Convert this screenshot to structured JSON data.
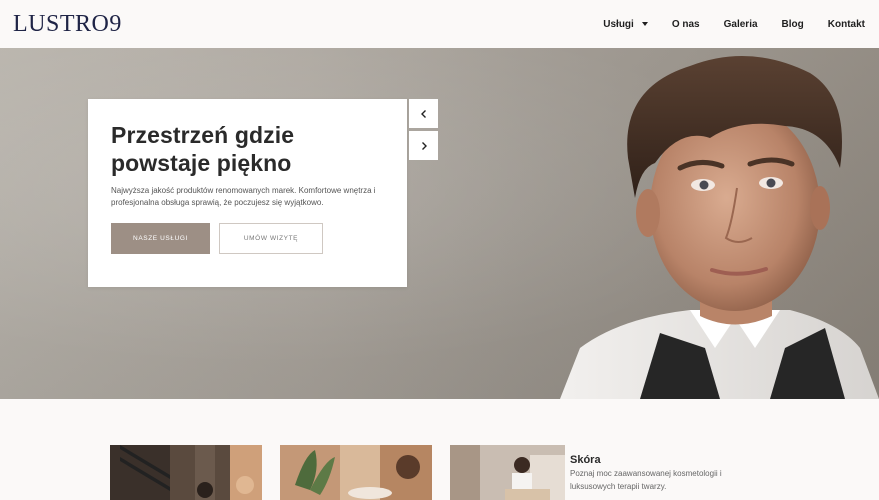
{
  "brand": {
    "logo_text": "LUSTRO9"
  },
  "nav": {
    "items": [
      {
        "label": "Usługi",
        "has_dropdown": true
      },
      {
        "label": "O nas"
      },
      {
        "label": "Galeria"
      },
      {
        "label": "Blog"
      },
      {
        "label": "Kontakt"
      }
    ]
  },
  "hero": {
    "title": "Przestrzeń gdzie powstaje piękno",
    "description": "Najwyższa jakość produktów renomowanych marek. Komfortowe wnętrza i profesjonalna obsługa sprawią, że poczujesz się wyjątkowo.",
    "primary_button": "NASZE USŁUGI",
    "secondary_button": "UMÓW WIZYTĘ",
    "prev_icon": "chevron-left-icon",
    "next_icon": "chevron-right-icon"
  },
  "services": {
    "featured": {
      "title": "Skóra",
      "description": "Poznaj moc zaawansowanej kosmetologii i luksusowych terapii twarzy."
    }
  },
  "colors": {
    "accent": "#9d8f85",
    "logo": "#1f2446",
    "background": "#fbf9f8"
  }
}
